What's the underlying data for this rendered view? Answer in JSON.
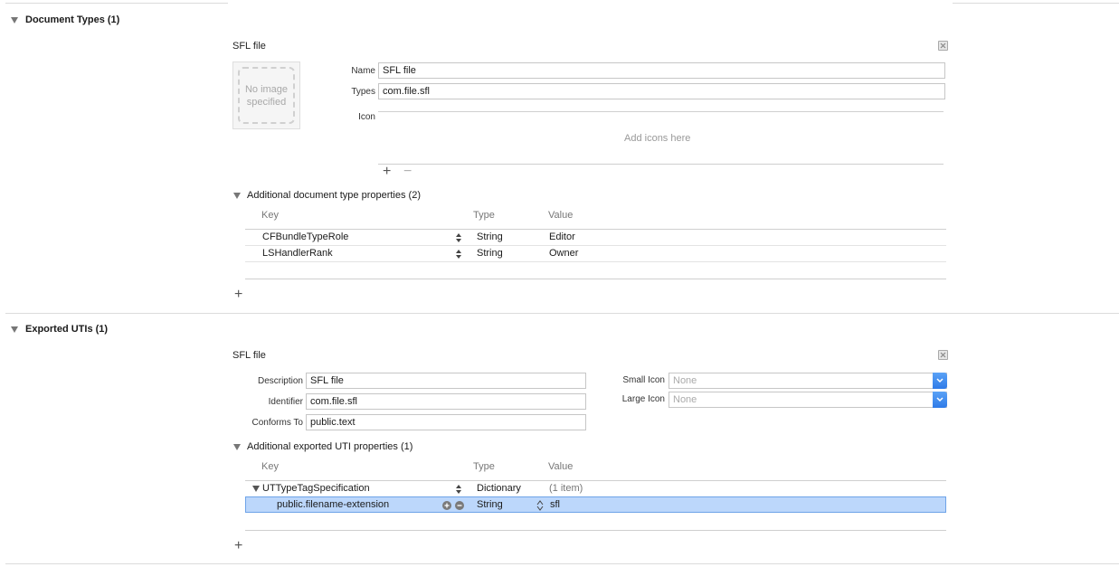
{
  "document_types": {
    "section_title": "Document Types (1)",
    "item_title": "SFL file",
    "image_placeholder": "No image specified",
    "name_label": "Name",
    "name_value": "SFL file",
    "types_label": "Types",
    "types_value": "com.file.sfl",
    "icon_label": "Icon",
    "add_icons_text": "Add icons here",
    "add_icon_plus": "+",
    "remove_icon_minus": "−",
    "additional_title": "Additional document type properties (2)",
    "columns": {
      "key": "Key",
      "type": "Type",
      "value": "Value"
    },
    "rows": [
      {
        "key": "CFBundleTypeRole",
        "type": "String",
        "value": "Editor"
      },
      {
        "key": "LSHandlerRank",
        "type": "String",
        "value": "Owner"
      }
    ],
    "add_property_plus": "+"
  },
  "exported_utis": {
    "section_title": "Exported UTIs (1)",
    "item_title": "SFL file",
    "description_label": "Description",
    "description_value": "SFL file",
    "identifier_label": "Identifier",
    "identifier_value": "com.file.sfl",
    "conforms_label": "Conforms To",
    "conforms_value": "public.text",
    "small_icon_label": "Small Icon",
    "small_icon_value": "None",
    "large_icon_label": "Large Icon",
    "large_icon_value": "None",
    "additional_title": "Additional exported UTI properties (1)",
    "columns": {
      "key": "Key",
      "type": "Type",
      "value": "Value"
    },
    "rows": [
      {
        "key": "UTTypeTagSpecification",
        "type": "Dictionary",
        "value": "(1 item)"
      },
      {
        "key": "public.filename-extension",
        "type": "String",
        "value": "sfl"
      }
    ],
    "add_property_plus": "+"
  },
  "colors": {
    "selection": "#bcd7fb",
    "popup_accent": "#2f7be8"
  }
}
